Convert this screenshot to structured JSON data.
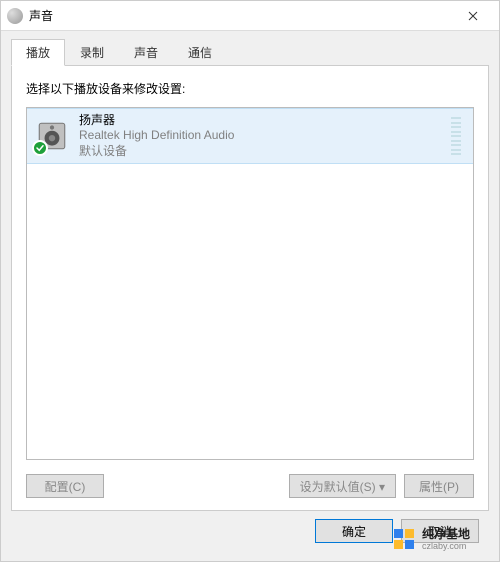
{
  "window": {
    "title": "声音"
  },
  "tabs": {
    "playback": "播放",
    "recording": "录制",
    "sounds": "声音",
    "comm": "通信"
  },
  "instruction": "选择以下播放设备来修改设置:",
  "device": {
    "name": "扬声器",
    "desc": "Realtek High Definition Audio",
    "status": "默认设备"
  },
  "panel_btns": {
    "configure": "配置(C)",
    "set_default": "设为默认值(S)  ▾",
    "properties": "属性(P)"
  },
  "dialog_btns": {
    "ok": "确定",
    "cancel": "取消"
  },
  "watermark": {
    "main": "纯净基地",
    "sub": "czlaby.com"
  }
}
